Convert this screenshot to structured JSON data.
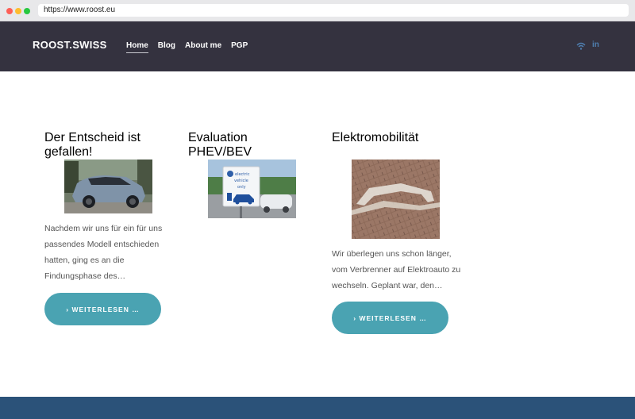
{
  "browser": {
    "url": "https://www.roost.eu"
  },
  "header": {
    "brand": "ROOST.SWISS",
    "nav": [
      "Home",
      "Blog",
      "About me",
      "PGP"
    ],
    "social_icons": [
      "wifi-icon",
      "linkedin-icon"
    ],
    "linkedin_text": "in"
  },
  "posts": [
    {
      "title": "Der Entscheid ist gefallen!",
      "excerpt": [
        "Nachdem wir uns für ein für uns",
        "passendes Modell entschieden",
        "hatten, ging es an die",
        "Findungsphase des…"
      ],
      "button": "› WEITERLESEN …"
    },
    {
      "title": "Evaluation PHEV/BEV",
      "excerpt": [],
      "button": "",
      "sign_text": [
        "electric",
        "vehicle",
        "only"
      ]
    },
    {
      "title": "Elektromobilität",
      "excerpt": [
        "Wir überlegen uns schon länger,",
        "vom Verbrenner auf Elektroauto zu",
        "wechseln. Geplant war, den…"
      ],
      "button": "› WEITERLESEN …"
    }
  ],
  "colors": {
    "header_bg": "#34323f",
    "title": "#2d4e7d",
    "button": "#4aa3b2",
    "footer": "#2b5279"
  }
}
